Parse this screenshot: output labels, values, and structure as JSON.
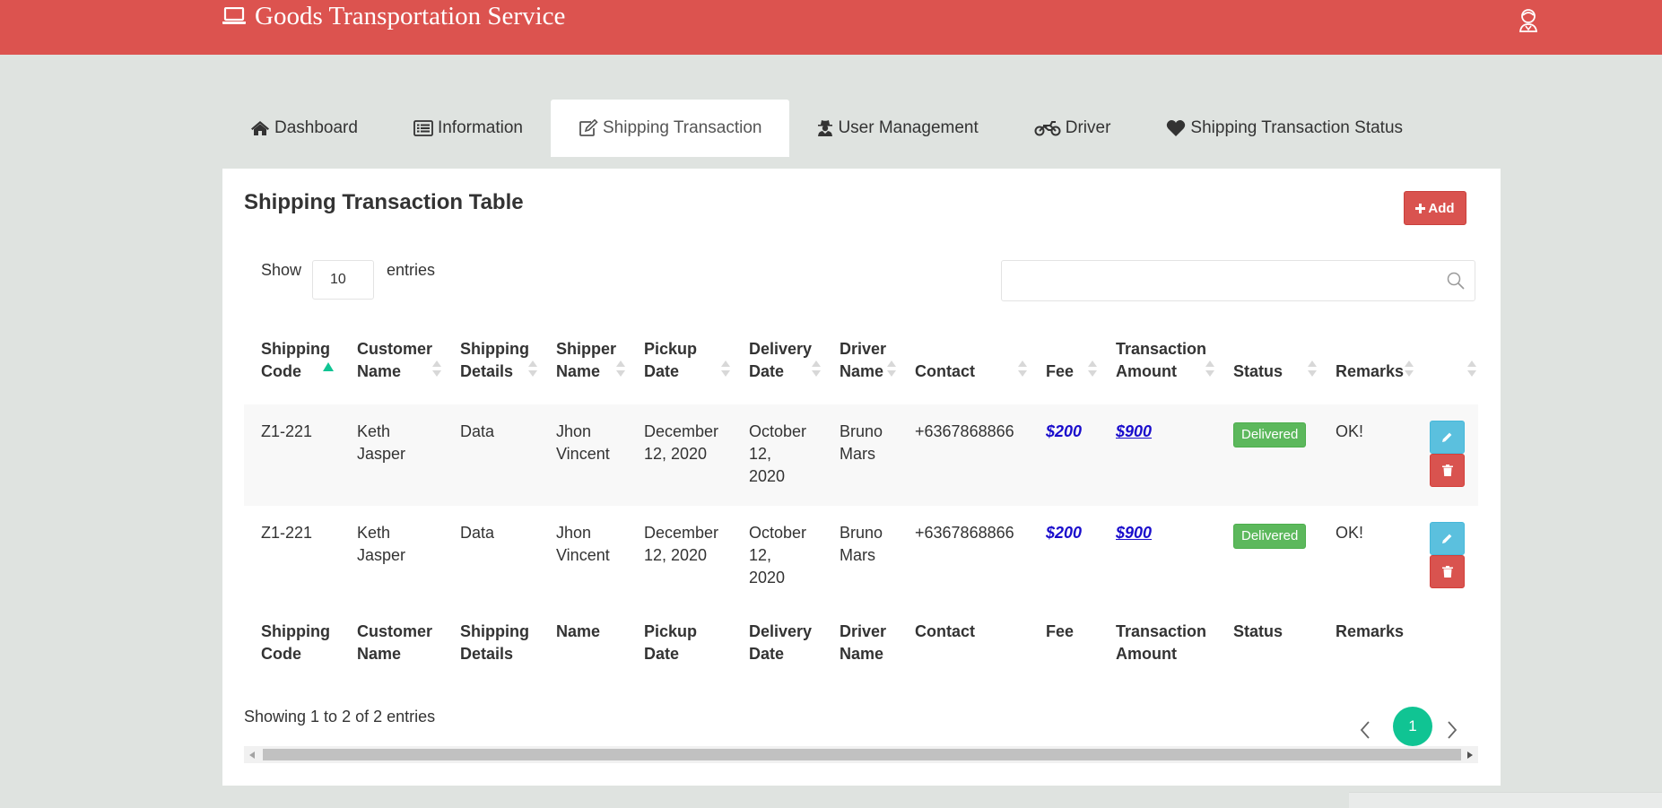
{
  "header": {
    "title": "Goods Transportation Service"
  },
  "tabs": [
    {
      "label": "Dashboard",
      "icon": "home-icon",
      "active": false
    },
    {
      "label": "Information",
      "icon": "list-icon",
      "active": false
    },
    {
      "label": "Shipping Transaction",
      "icon": "edit-icon",
      "active": true
    },
    {
      "label": "User Management",
      "icon": "user-secret-icon",
      "active": false
    },
    {
      "label": "Driver",
      "icon": "motorcycle-icon",
      "active": false
    },
    {
      "label": "Shipping Transaction Status",
      "icon": "heart-icon",
      "active": false
    }
  ],
  "panel": {
    "title": "Shipping Transaction Table",
    "add_label": "Add"
  },
  "controls": {
    "show_label": "Show",
    "entries_value": "10",
    "entries_label": "entries",
    "search_value": ""
  },
  "table": {
    "headers": [
      {
        "line1": "Shipping",
        "line2": "Code"
      },
      {
        "line1": "Customer",
        "line2": "Name"
      },
      {
        "line1": "Shipping",
        "line2": "Details"
      },
      {
        "line1": "Shipper",
        "line2": "Name"
      },
      {
        "line1": "Pickup",
        "line2": "Date"
      },
      {
        "line1": "Delivery",
        "line2": "Date"
      },
      {
        "line1": "Driver",
        "line2": "Name"
      },
      {
        "line1": "",
        "line2": "Contact"
      },
      {
        "line1": "",
        "line2": "Fee"
      },
      {
        "line1": "Transaction",
        "line2": "Amount"
      },
      {
        "line1": "",
        "line2": "Status"
      },
      {
        "line1": "",
        "line2": "Remarks"
      }
    ],
    "rows": [
      {
        "code": "Z1-221",
        "customer": "Keth Jasper",
        "details": "Data",
        "shipper": "Jhon Vincent",
        "pickup": "December 12, 2020",
        "delivery": "October 12, 2020",
        "driver": "Bruno Mars",
        "contact": "+6367868866",
        "fee": "$200",
        "amount": "$900",
        "status": "Delivered",
        "remarks": "OK!"
      },
      {
        "code": "Z1-221",
        "customer": "Keth Jasper",
        "details": "Data",
        "shipper": "Jhon Vincent",
        "pickup": "December 12, 2020",
        "delivery": "October 12, 2020",
        "driver": "Bruno Mars",
        "contact": "+6367868866",
        "fee": "$200",
        "amount": "$900",
        "status": "Delivered",
        "remarks": "OK!"
      }
    ],
    "footer": [
      {
        "line1": "Shipping",
        "line2": "Code"
      },
      {
        "line1": "Customer",
        "line2": "Name"
      },
      {
        "line1": "Shipping",
        "line2": "Details"
      },
      {
        "line1": "Name",
        "line2": ""
      },
      {
        "line1": "Pickup",
        "line2": "Date"
      },
      {
        "line1": "Delivery",
        "line2": "Date"
      },
      {
        "line1": "Driver",
        "line2": "Name"
      },
      {
        "line1": "Contact",
        "line2": ""
      },
      {
        "line1": "Fee",
        "line2": ""
      },
      {
        "line1": "Transaction",
        "line2": "Amount"
      },
      {
        "line1": "Status",
        "line2": ""
      },
      {
        "line1": "Remarks",
        "line2": ""
      }
    ]
  },
  "pagination": {
    "info": "Showing 1 to 2 of 2 entries",
    "current_page": "1"
  },
  "colors": {
    "header_bg": "#dc534f",
    "page_bg": "#dfe3e0",
    "accent_green": "#10c493",
    "badge_green": "#5cb85c",
    "edit_blue": "#5bc0de",
    "delete_red": "#d9534f",
    "link_blue": "#1a0dcc"
  }
}
